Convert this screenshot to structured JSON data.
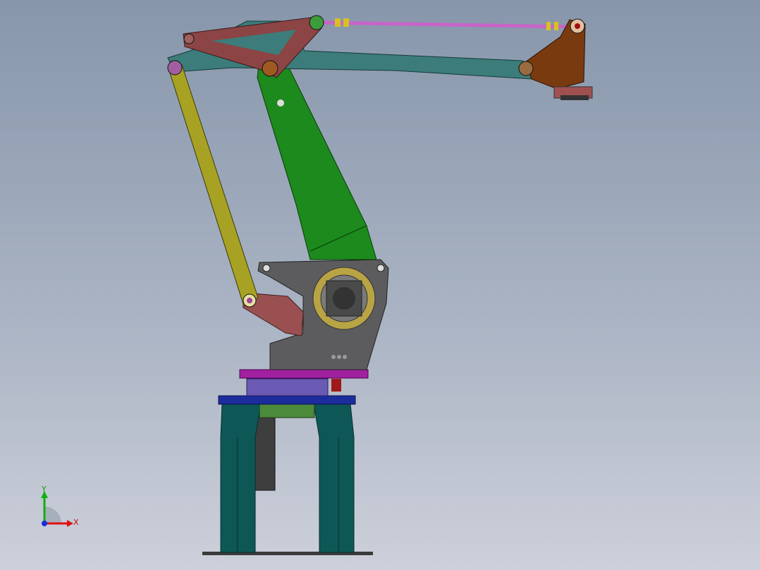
{
  "viewport": {
    "triad": {
      "x_label": "X",
      "y_label": "Y"
    }
  },
  "colors": {
    "base_leg": "#0d5856",
    "upper_arm": "#1c8a1c",
    "forearm": "#3c7c7a",
    "link_triangle": "#8c4444",
    "parallel_rod": "#a8a224",
    "body": "#5c5c5e",
    "bearing": "#b8a444",
    "turntable_plate": "#a020a0",
    "blue_plate": "#1c2c9c",
    "bearing_ring": "#6a5ab4",
    "tie_rod": "#c864c8",
    "end_effector": "#7a3a10"
  }
}
